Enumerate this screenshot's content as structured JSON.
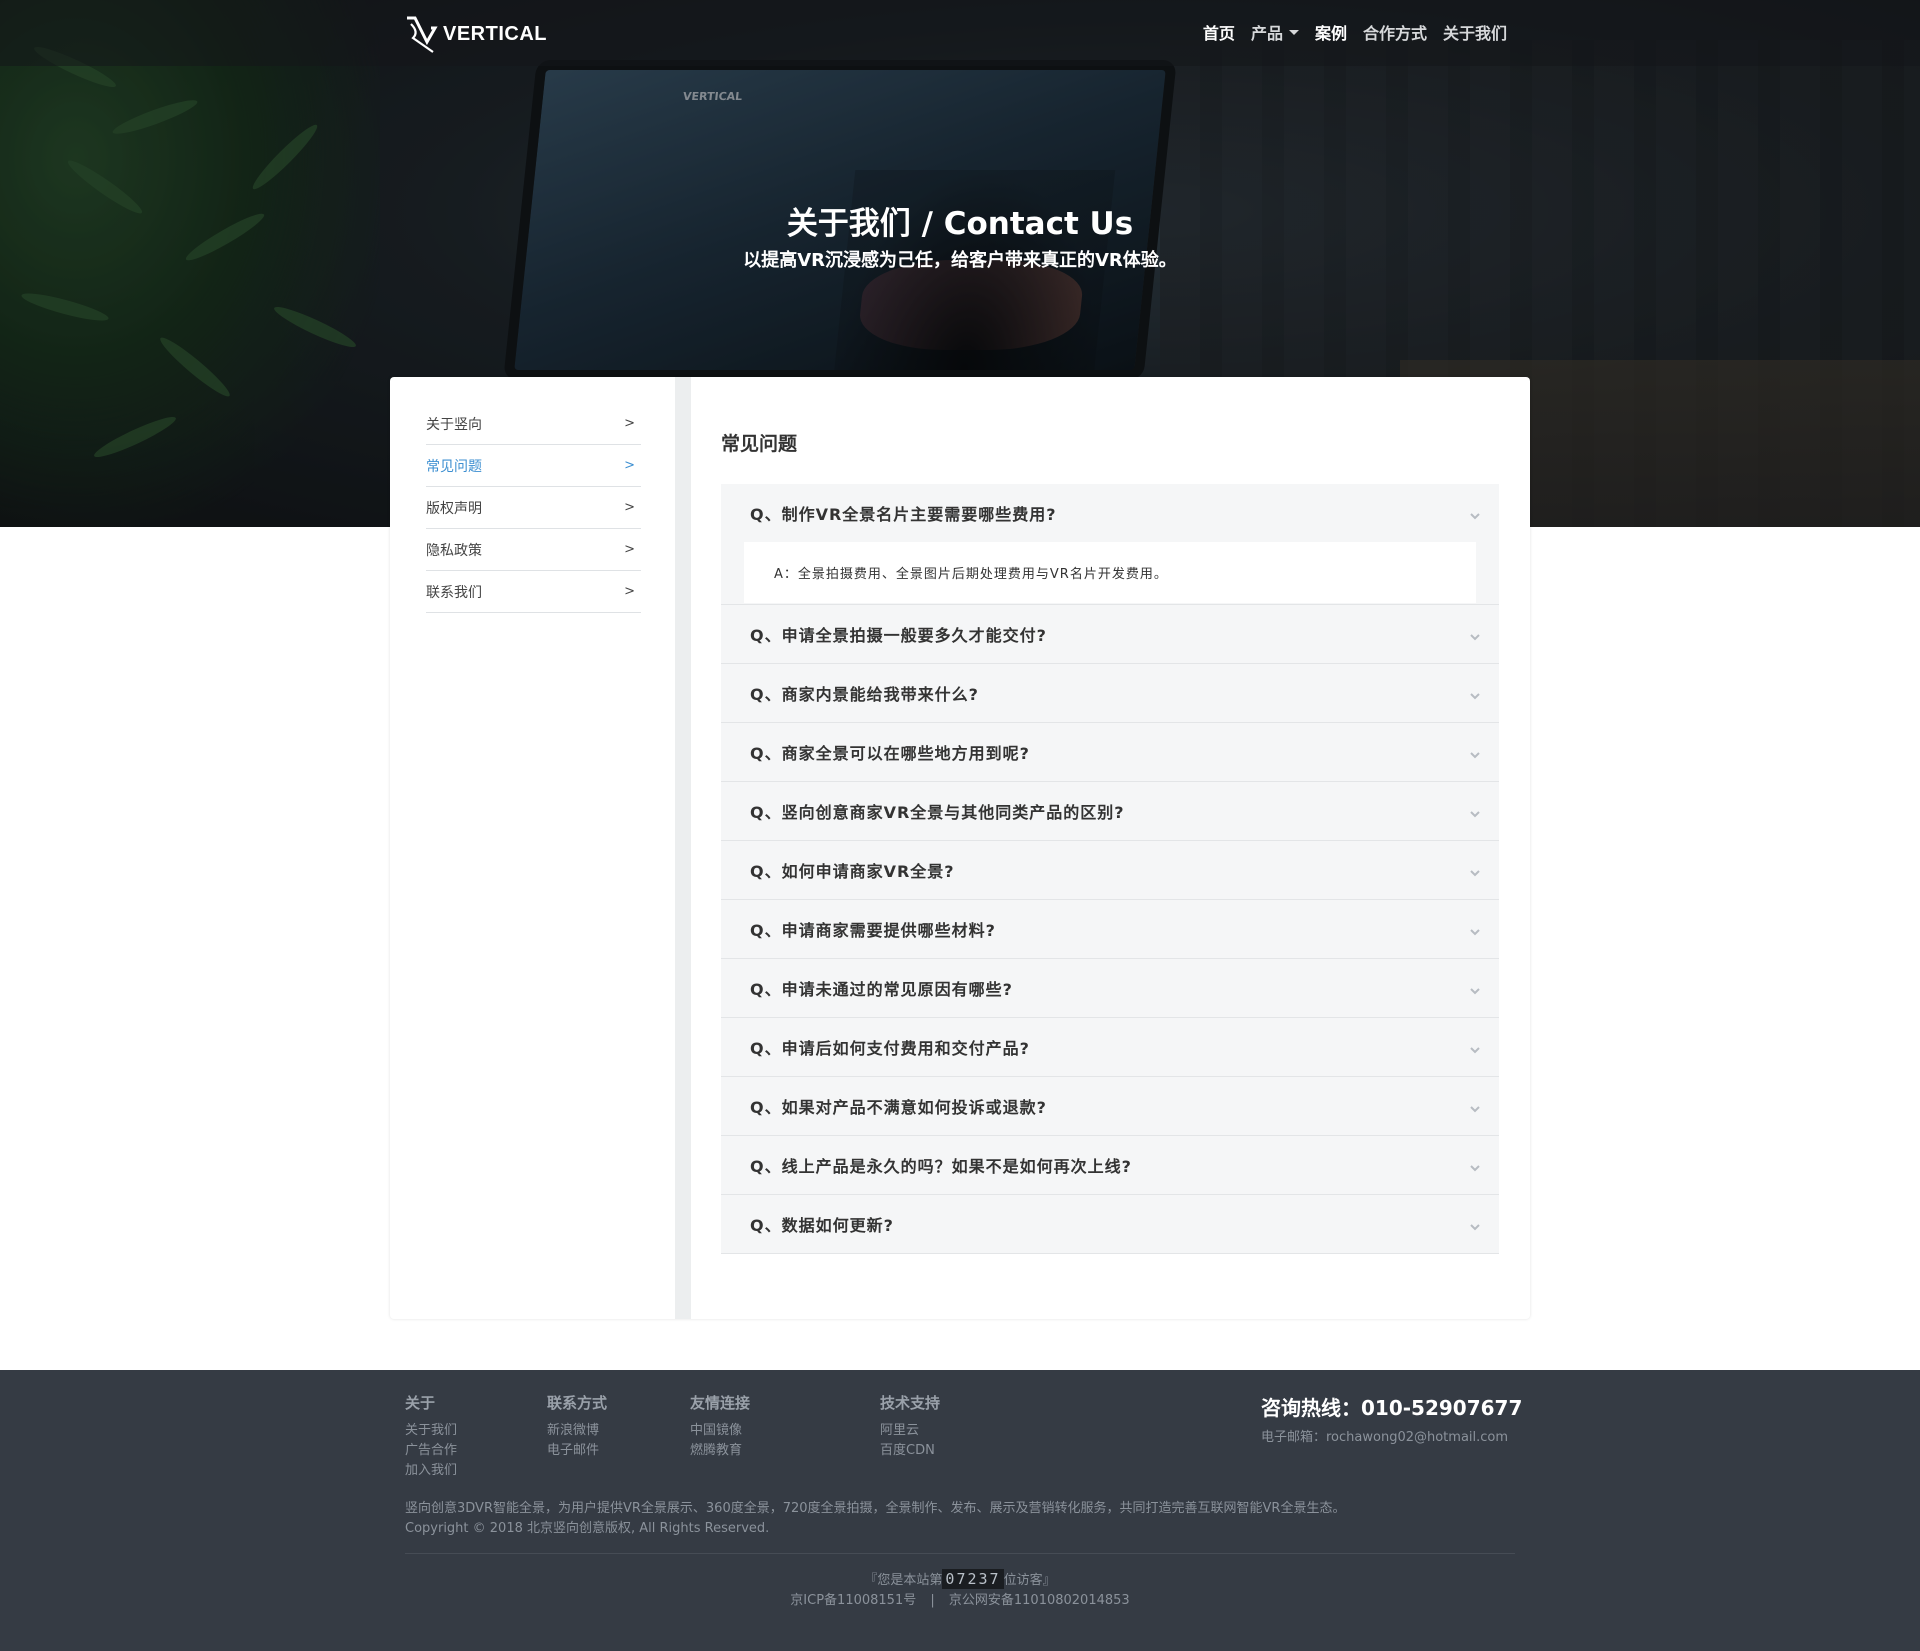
{
  "nav": {
    "logo_text": "VERTICAL",
    "items": [
      {
        "label": "首页"
      },
      {
        "label": "产品"
      },
      {
        "label": "案例"
      },
      {
        "label": "合作方式"
      },
      {
        "label": "关于我们"
      }
    ]
  },
  "hero": {
    "title": "关于我们 / Contact Us",
    "subtitle": "以提高VR沉浸感为己任，给客户带来真正的VR体验。",
    "screen_logo": "VERTICAL"
  },
  "sidebar": {
    "items": [
      {
        "label": "关于竖向",
        "arrow": ">"
      },
      {
        "label": "常见问题",
        "arrow": ">"
      },
      {
        "label": "版权声明",
        "arrow": ">"
      },
      {
        "label": "隐私政策",
        "arrow": ">"
      },
      {
        "label": "联系我们",
        "arrow": ">"
      }
    ],
    "active_index": 1
  },
  "main": {
    "title": "常见问题",
    "faqs": [
      {
        "q": "Q、制作VR全景名片主要需要哪些费用?",
        "a": "A：全景拍摄费用、全景图片后期处理费用与VR名片开发费用。"
      },
      {
        "q": "Q、申请全景拍摄一般要多久才能交付?"
      },
      {
        "q": "Q、商家内景能给我带来什么?"
      },
      {
        "q": "Q、商家全景可以在哪些地方用到呢?"
      },
      {
        "q": "Q、竖向创意商家VR全景与其他同类产品的区别?"
      },
      {
        "q": "Q、如何申请商家VR全景?"
      },
      {
        "q": "Q、申请商家需要提供哪些材料?"
      },
      {
        "q": "Q、申请未通过的常见原因有哪些?"
      },
      {
        "q": "Q、申请后如何支付费用和交付产品?"
      },
      {
        "q": "Q、如果对产品不满意如何投诉或退款?"
      },
      {
        "q": "Q、线上产品是永久的吗？如果不是如何再次上线?"
      },
      {
        "q": "Q、数据如何更新?"
      }
    ]
  },
  "footer": {
    "cols": [
      {
        "title": "关于",
        "links": [
          "关于我们",
          "广告合作",
          "加入我们"
        ]
      },
      {
        "title": "联系方式",
        "links": [
          "新浪微博",
          "电子邮件"
        ]
      },
      {
        "title": "友情连接",
        "links": [
          "中国镜像",
          "燃腾教育"
        ]
      },
      {
        "title": "技术支持",
        "links": [
          "阿里云",
          "百度CDN"
        ]
      }
    ],
    "hotline": "咨询热线：010-52907677",
    "email": "电子邮箱：rochawong02@hotmail.com",
    "desc": "竖向创意3DVR智能全景，为用户提供VR全景展示、360度全景，720度全景拍摄，全景制作、发布、展示及营销转化服务，共同打造完善互联网智能VR全景生态。",
    "copyright": "Copyright © 2018 北京竖向创意版权, All Rights Reserved.",
    "visit_prefix": "『您是本站第",
    "visit_count": "07237",
    "visit_suffix": "位访客』",
    "icp": "京ICP备11008151号",
    "sep": "|",
    "police": "京公网安备11010802014853"
  },
  "colors": {
    "accent": "#3d8fd1",
    "footer_bg": "#353b44",
    "faq_bg": "#f5f6f7"
  }
}
